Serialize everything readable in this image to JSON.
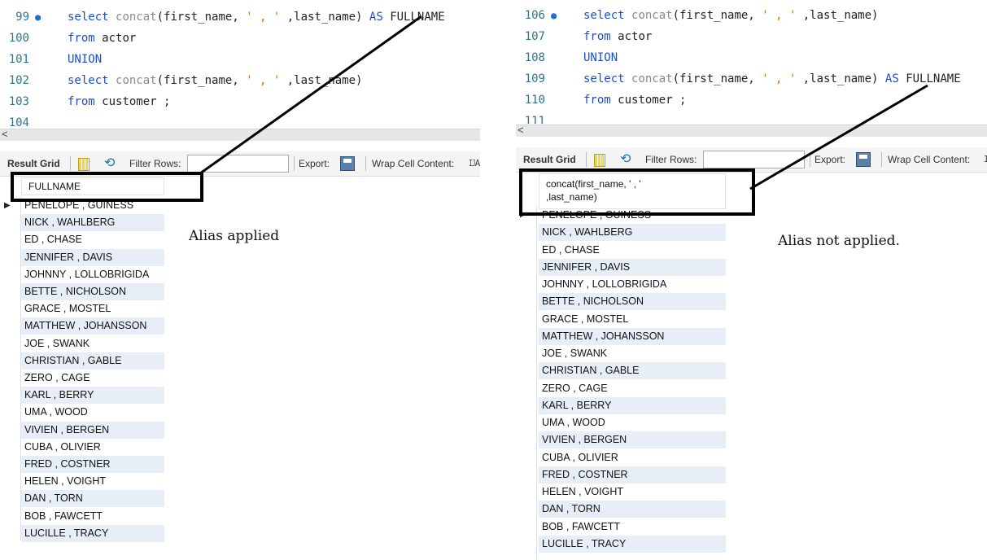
{
  "left": {
    "editor_lines": [
      {
        "num": "99",
        "breakpoint": true,
        "tokens": [
          [
            "kw",
            "select "
          ],
          [
            "fn",
            "concat"
          ],
          [
            "id",
            "(first_name, "
          ],
          [
            "str",
            "' , '"
          ],
          [
            "id",
            " ,last_name) "
          ],
          [
            "kw",
            "AS "
          ],
          [
            "id",
            "FULLNAME"
          ]
        ]
      },
      {
        "num": "100",
        "tokens": [
          [
            "kw",
            "from "
          ],
          [
            "id",
            "actor"
          ]
        ]
      },
      {
        "num": "101",
        "tokens": [
          [
            "kw",
            "UNION"
          ]
        ]
      },
      {
        "num": "102",
        "tokens": [
          [
            "kw",
            "select "
          ],
          [
            "fn",
            "concat"
          ],
          [
            "id",
            "(first_name, "
          ],
          [
            "str",
            "' , '"
          ],
          [
            "id",
            " ,last_name)"
          ]
        ]
      },
      {
        "num": "103",
        "tokens": [
          [
            "kw",
            "from "
          ],
          [
            "id",
            "customer ;"
          ]
        ]
      },
      {
        "num": "104",
        "tokens": []
      }
    ],
    "toolbar": {
      "result_grid": "Result Grid",
      "filter_rows": "Filter Rows:",
      "export": "Export:",
      "wrap_cell": "Wrap Cell Content:",
      "wrap_icon": "ĲA"
    },
    "column_header": "FULLNAME",
    "annotation": "Alias applied"
  },
  "right": {
    "editor_lines": [
      {
        "num": "106",
        "breakpoint": true,
        "tokens": [
          [
            "kw",
            "select "
          ],
          [
            "fn",
            "concat"
          ],
          [
            "id",
            "(first_name, "
          ],
          [
            "str",
            "' , '"
          ],
          [
            "id",
            " ,last_name)"
          ]
        ]
      },
      {
        "num": "107",
        "tokens": [
          [
            "kw",
            "from "
          ],
          [
            "id",
            "actor"
          ]
        ]
      },
      {
        "num": "108",
        "tokens": [
          [
            "kw",
            "UNION"
          ]
        ]
      },
      {
        "num": "109",
        "tokens": [
          [
            "kw",
            "select "
          ],
          [
            "fn",
            "concat"
          ],
          [
            "id",
            "(first_name, "
          ],
          [
            "str",
            "' , '"
          ],
          [
            "id",
            " ,last_name) "
          ],
          [
            "kw",
            "AS "
          ],
          [
            "id",
            "FULLNAME"
          ]
        ]
      },
      {
        "num": "110",
        "tokens": [
          [
            "kw",
            "from "
          ],
          [
            "id",
            "customer ;"
          ]
        ]
      },
      {
        "num": "111",
        "tokens": []
      }
    ],
    "toolbar": {
      "result_grid": "Result Grid",
      "filter_rows": "Filter Rows:",
      "export": "Export:",
      "wrap_cell": "Wrap Cell Content:",
      "wrap_icon": "I"
    },
    "column_header_line1": "concat(first_name, ' , '",
    "column_header_line2": ",last_name)",
    "annotation": "Alias not applied."
  },
  "result_rows": [
    "PENELOPE , GUINESS",
    "NICK , WAHLBERG",
    "ED , CHASE",
    "JENNIFER , DAVIS",
    "JOHNNY , LOLLOBRIGIDA",
    "BETTE , NICHOLSON",
    "GRACE , MOSTEL",
    "MATTHEW , JOHANSSON",
    "JOE , SWANK",
    "CHRISTIAN , GABLE",
    "ZERO , CAGE",
    "KARL , BERRY",
    "UMA , WOOD",
    "VIVIEN , BERGEN",
    "CUBA , OLIVIER",
    "FRED , COSTNER",
    "HELEN , VOIGHT",
    "DAN , TORN",
    "BOB , FAWCETT",
    "LUCILLE , TRACY"
  ],
  "colors": {
    "keyword": "#1c4cd6",
    "string": "#e06a00",
    "function": "#8a8a8a",
    "line_number": "#237893",
    "row_stripe": "#e8eef8"
  }
}
